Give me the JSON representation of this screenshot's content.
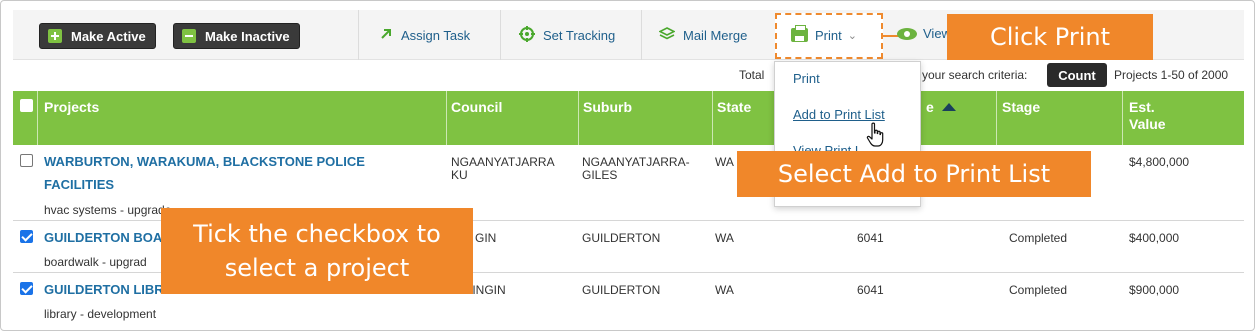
{
  "toolbar": {
    "make_active": "Make Active",
    "make_inactive": "Make Inactive",
    "assign_task": "Assign Task",
    "set_tracking": "Set Tracking",
    "mail_merge": "Mail Merge",
    "print": "Print",
    "view": "View"
  },
  "count_row": {
    "total_text": "Total",
    "criteria_text": "your search criteria:",
    "count_button": "Count",
    "range_text": "Projects 1-50 of 2000"
  },
  "dropdown": {
    "items": [
      "Print",
      "Add to Print List",
      "View Print List"
    ],
    "item3_visible": "View Print L"
  },
  "table": {
    "headers": {
      "projects": "Projects",
      "council": "Council",
      "suburb": "Suburb",
      "state": "State",
      "postcode_partial": "e",
      "stage": "Stage",
      "est_value_1": "Est.",
      "est_value_2": "Value"
    },
    "rows": [
      {
        "title_line1": "WARBURTON, WARAKUMA, BLACKSTONE POLICE",
        "title_line2": "FACILITIES",
        "sub": "hvac systems - upgrade",
        "council_1": "NGAANYATJARRA",
        "council_2": "KU",
        "suburb_1": "NGAANYATJARRA-",
        "suburb_2": "GILES",
        "state": "WA",
        "postcode": "",
        "stage": "",
        "value": "$4,800,000",
        "checked": false
      },
      {
        "title_line1": "GUILDERTON BOA",
        "sub": "boardwalk - upgrad",
        "council_1": "GIN",
        "suburb_1": "GUILDERTON",
        "state": "WA",
        "postcode": "6041",
        "stage": "Completed",
        "value": "$400,000",
        "checked": true
      },
      {
        "title_line1": "GUILDERTON LIBRARY",
        "sub": "library - development",
        "council_1": "GINGIN",
        "suburb_1": "GUILDERTON",
        "state": "WA",
        "postcode": "6041",
        "stage": "Completed",
        "value": "$900,000",
        "checked": true
      }
    ]
  },
  "callouts": {
    "click_print": "Click Print",
    "select_add": "Select Add to Print List",
    "tick_1": "Tick the checkbox to",
    "tick_2": "select a project"
  },
  "colors": {
    "accent_green": "#7fc242",
    "callout_orange": "#f0872a",
    "link_blue": "#1f6fa3"
  }
}
